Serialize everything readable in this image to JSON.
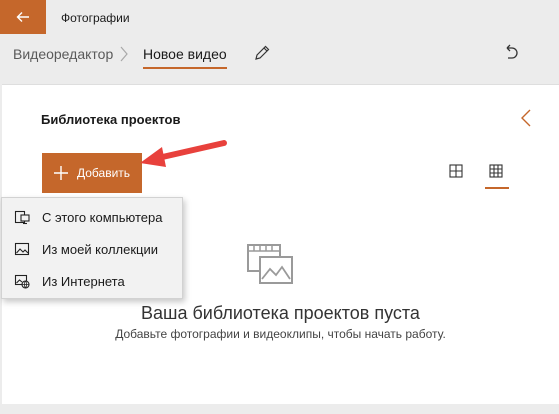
{
  "titlebar": {
    "app_title": "Фотографии"
  },
  "breadcrumb": {
    "root": "Видеоредактор",
    "current": "Новое видео"
  },
  "library": {
    "title": "Библиотека проектов",
    "add_label": "Добавить"
  },
  "add_menu": {
    "items": [
      {
        "label": "С этого компьютера",
        "icon": "computer-icon"
      },
      {
        "label": "Из моей коллекции",
        "icon": "collection-icon"
      },
      {
        "label": "Из Интернета",
        "icon": "web-image-icon"
      }
    ]
  },
  "empty_state": {
    "title": "Ваша библиотека проектов пуста",
    "subtitle": "Добавьте фотографии и видеоклипы, чтобы начать работу."
  },
  "colors": {
    "accent": "#c5672b",
    "annotation_arrow": "#e8413c"
  }
}
